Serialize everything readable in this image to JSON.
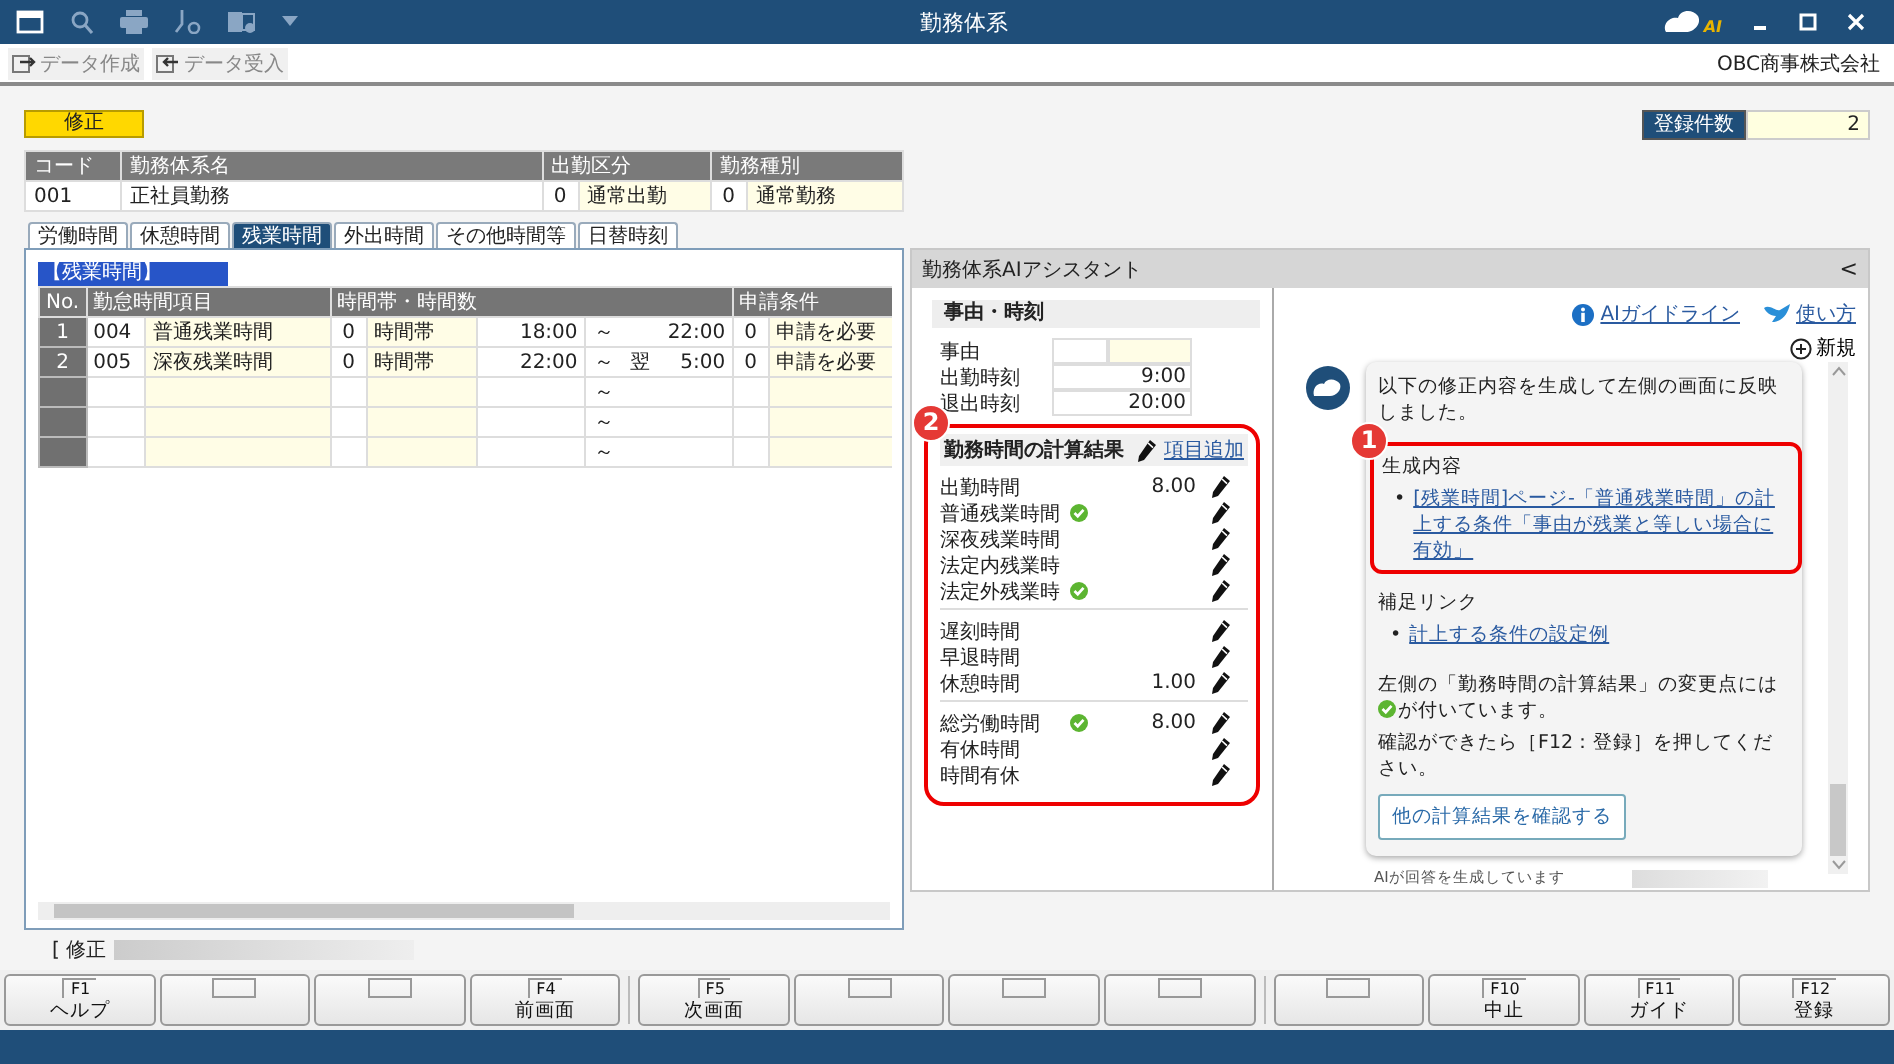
{
  "window": {
    "title": "勤務体系",
    "logo_text": "AI"
  },
  "toolbar": {
    "buttons": [
      {
        "label": "データ作成",
        "disabled": true
      },
      {
        "label": "データ受入",
        "disabled": true
      }
    ],
    "company": "OBC商事株式会社"
  },
  "mode_badge": "修正",
  "record_count": {
    "label": "登録件数",
    "value": "2"
  },
  "header_table": {
    "columns": [
      "コード",
      "勤務体系名",
      "出勤区分",
      "勤務種別"
    ],
    "row": {
      "code": "001",
      "name": "正社員勤務",
      "attendance_code": "0",
      "attendance": "通常出勤",
      "work_type_code": "0",
      "work_type": "通常勤務"
    }
  },
  "tabs": [
    {
      "label": "労働時間",
      "selected": false
    },
    {
      "label": "休憩時間",
      "selected": false
    },
    {
      "label": "残業時間",
      "selected": true
    },
    {
      "label": "外出時間",
      "selected": false
    },
    {
      "label": "その他時間等",
      "selected": false
    },
    {
      "label": "日替時刻",
      "selected": false
    }
  ],
  "section_label": "【残業時間】",
  "grid": {
    "columns": [
      "No.",
      "勤怠時間項目",
      "時間帯・時間数",
      "申請条件"
    ],
    "rows": [
      {
        "no": "1",
        "code": "004",
        "item": "普通残業時間",
        "type_code": "0",
        "type": "時間帯",
        "start": "18:00",
        "sep": "～",
        "end": "22:00",
        "cond_code": "0",
        "condition": "申請を必要"
      },
      {
        "no": "2",
        "code": "005",
        "item": "深夜残業時間",
        "type_code": "0",
        "type": "時間帯",
        "start": "22:00",
        "sep": "～",
        "next_day": "翌",
        "end": "5:00",
        "cond_code": "0",
        "condition": "申請を必要"
      },
      {
        "sep": "～"
      },
      {
        "sep": "～"
      },
      {
        "sep": "～"
      }
    ]
  },
  "ai_panel": {
    "title": "勤務体系AIアシスタント",
    "collapse": "<",
    "reason": {
      "title": "事由・時刻",
      "fields": [
        {
          "label": "事由",
          "kind": "pair"
        },
        {
          "label": "出勤時刻",
          "value": "9:00",
          "kind": "time"
        },
        {
          "label": "退出時刻",
          "value": "20:00",
          "kind": "time"
        }
      ]
    },
    "results": {
      "title": "勤務時間の計算結果",
      "add_link": "項目追加",
      "callout": "2",
      "groups": [
        {
          "items": [
            {
              "name": "出勤時間",
              "changed": false,
              "value": "8.00"
            },
            {
              "name": "普通残業時間",
              "changed": true
            },
            {
              "name": "深夜残業時間",
              "changed": false
            },
            {
              "name": "法定内残業時",
              "changed": false
            },
            {
              "name": "法定外残業時",
              "changed": true
            }
          ]
        },
        {
          "items": [
            {
              "name": "遅刻時間",
              "changed": false
            },
            {
              "name": "早退時間",
              "changed": false
            },
            {
              "name": "休憩時間",
              "changed": false,
              "value": "1.00"
            }
          ]
        },
        {
          "items": [
            {
              "name": "総労働時間",
              "changed": true,
              "value": "8.00"
            },
            {
              "name": "有休時間",
              "changed": false
            },
            {
              "name": "時間有休",
              "changed": false
            }
          ]
        }
      ]
    },
    "links": [
      {
        "label": "AIガイドライン",
        "kind": "info"
      },
      {
        "label": "使い方",
        "kind": "bird"
      }
    ],
    "new_chat": "新規",
    "message": {
      "intro": "以下の修正内容を生成して左側の画面に反映しました。",
      "generated_title": "生成内容",
      "generated_items": [
        {
          "bullet": "•",
          "text": "[残業時間]ページ-「普通残業時間」の計上する条件「事由が残業と等しい場合に有効」"
        }
      ],
      "callout": "1",
      "supplement_title": "補足リンク",
      "supplement_items": [
        {
          "bullet": "•",
          "text": "計上する条件の設定例"
        }
      ],
      "note_before": "左側の「勤務時間の計算結果」の変更点には",
      "note_after": "が付いています。",
      "instruction": "確認ができたら［F12：登録］を押してください。",
      "button": "他の計算結果を確認する"
    },
    "status": "AIが回答を生成しています"
  },
  "status_line": "[ 修正",
  "function_keys": [
    {
      "key": "F1",
      "label": "ヘルプ"
    },
    {
      "kind": "blank"
    },
    {
      "kind": "blank"
    },
    {
      "key": "F4",
      "label": "前画面"
    },
    {
      "key": "F5",
      "label": "次画面"
    },
    {
      "kind": "blank"
    },
    {
      "kind": "blank"
    },
    {
      "kind": "blank"
    },
    {
      "kind": "blank"
    },
    {
      "key": "F10",
      "label": "中止"
    },
    {
      "key": "F11",
      "label": "ガイド"
    },
    {
      "key": "F12",
      "label": "登録"
    }
  ]
}
